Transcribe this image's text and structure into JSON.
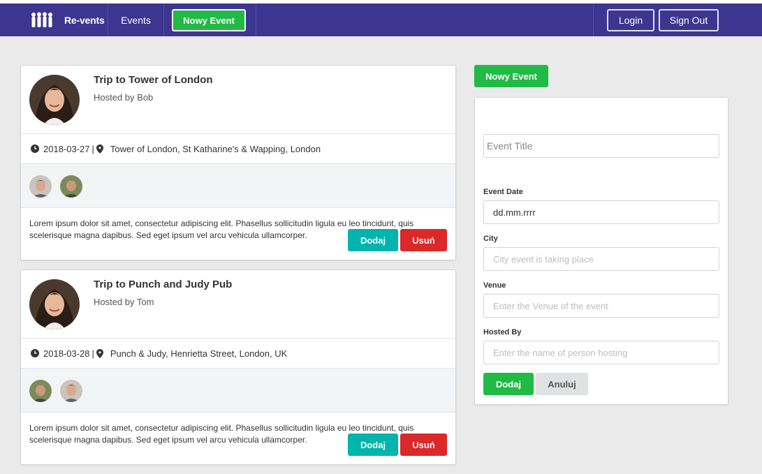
{
  "nav": {
    "brand": "Re-vents",
    "events_label": "Events",
    "new_event_label": "Nowy Event",
    "login_label": "Login",
    "signout_label": "Sign Out",
    "bg_color": "#3d3590",
    "logo_icon": "people-icon"
  },
  "events": [
    {
      "title": "Trip to Tower of London",
      "hosted_by": "Hosted by Bob",
      "date": "2018-03-27",
      "separator": "|",
      "venue": "Tower of London, St Katharine's & Wapping, London",
      "description": "Lorem ipsum dolor sit amet, consectetur adipiscing elit. Phasellus sollicitudin ligula eu leo tincidunt, quis scelerisque magna dapibus. Sed eget ipsum vel arcu vehicula ullamcorper.",
      "add_label": "Dodaj",
      "delete_label": "Usuń"
    },
    {
      "title": "Trip to Punch and Judy Pub",
      "hosted_by": "Hosted by Tom",
      "date": "2018-03-28",
      "separator": "|",
      "venue": "Punch & Judy, Henrietta Street, London, UK",
      "description": "Lorem ipsum dolor sit amet, consectetur adipiscing elit. Phasellus sollicitudin ligula eu leo tincidunt, quis scelerisque magna dapibus. Sed eget ipsum vel arcu vehicula ullamcorper.",
      "add_label": "Dodaj",
      "delete_label": "Usuń"
    }
  ],
  "sidebar": {
    "new_event_label": "Nowy Event"
  },
  "form": {
    "title_placeholder": "Event Title",
    "date_label": "Event Date",
    "date_value": "dd.mm.rrrr",
    "city_label": "City",
    "city_placeholder": "City event is taking place",
    "venue_label": "Venue",
    "venue_placeholder": "Enter the Venue of the event",
    "hosted_label": "Hosted By",
    "hosted_placeholder": "Enter the name of person hosting",
    "submit_label": "Dodaj",
    "cancel_label": "Anuluj"
  },
  "colors": {
    "green": "#21ba45",
    "teal": "#00b5ad",
    "red": "#db2828"
  }
}
